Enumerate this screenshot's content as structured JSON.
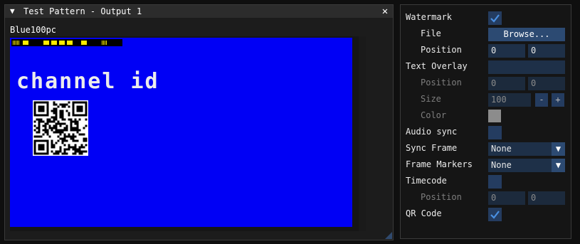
{
  "window": {
    "title": "Test Pattern - Output 1",
    "collapse_icon": "triangle-down-icon",
    "close_glyph": "✕",
    "image_label": "Blue100pc",
    "overlay_text": "channel id",
    "canvas_color": "#0000f5"
  },
  "panel": {
    "watermark_label": "Watermark",
    "watermark_checked": true,
    "file_label": "File",
    "browse_label": "Browse...",
    "wm_position_label": "Position",
    "wm_pos_x": "0",
    "wm_pos_y": "0",
    "text_overlay_label": "Text Overlay",
    "text_overlay_value": "",
    "to_position_label": "Position",
    "to_pos_x": "0",
    "to_pos_y": "0",
    "size_label": "Size",
    "size_value": "100",
    "size_minus": "-",
    "size_plus": "+",
    "color_label": "Color",
    "color_value": "#8c8c8c",
    "audio_sync_label": "Audio sync",
    "audio_sync_checked": false,
    "sync_frame_label": "Sync Frame",
    "sync_frame_value": "None",
    "frame_markers_label": "Frame Markers",
    "frame_markers_value": "None",
    "timecode_label": "Timecode",
    "timecode_checked": false,
    "tc_position_label": "Position",
    "tc_pos_x": "0",
    "tc_pos_y": "0",
    "qr_label": "QR Code",
    "qr_checked": true
  }
}
